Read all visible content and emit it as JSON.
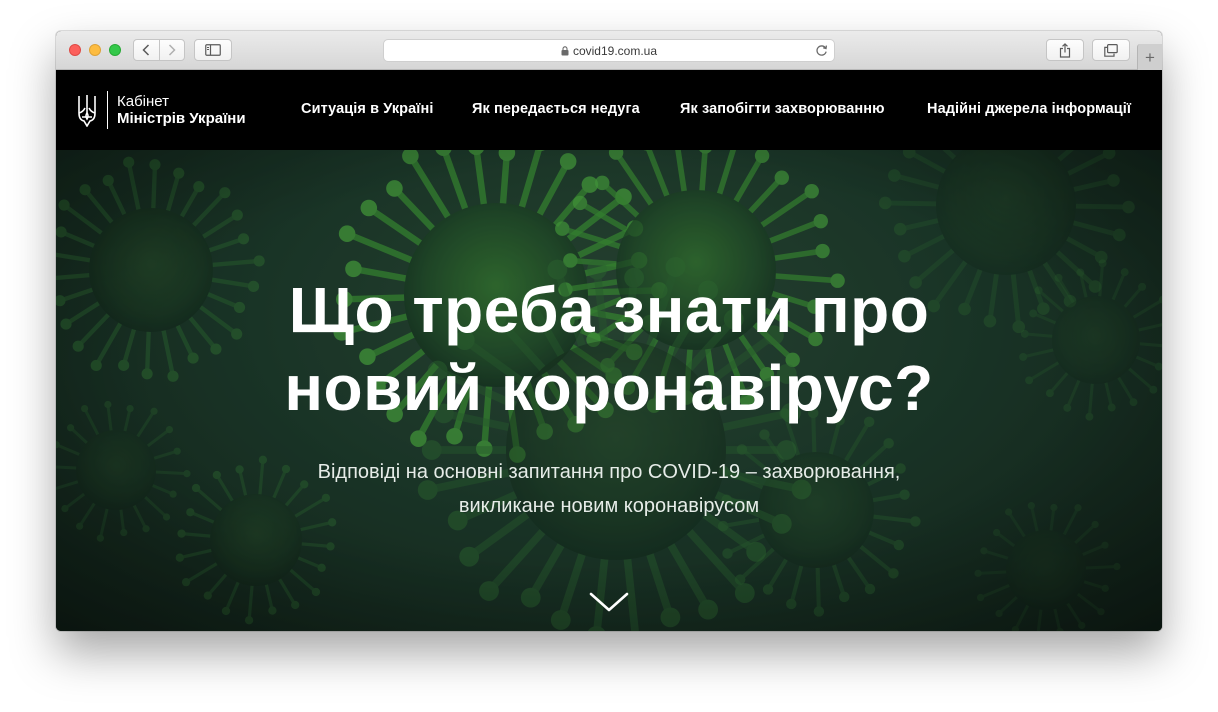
{
  "browser": {
    "url": "covid19.com.ua",
    "new_tab_glyph": "+"
  },
  "site": {
    "logo": {
      "line1": "Кабінет",
      "line2": "Міністрів України",
      "emblem_icon": "trident-icon"
    },
    "nav": [
      {
        "label": "Ситуація в Україні"
      },
      {
        "label": "Як передається недуга"
      },
      {
        "label": "Як запобігти захворюванню"
      },
      {
        "label": "Надійні джерела інформації"
      }
    ]
  },
  "hero": {
    "title_line1": "Що треба знати про",
    "title_line2": "новий коронавірус?",
    "subtitle_line1": "Відповіді на основні запитання про COVID-19 – захворювання,",
    "subtitle_line2": "викликане новим коронавірусом",
    "scroll_icon": "chevron-down-icon"
  },
  "colors": {
    "header_bg": "#000000",
    "hero_tint": "#1d3a2b",
    "virus_green": "#3fa83c",
    "text": "#ffffff"
  }
}
